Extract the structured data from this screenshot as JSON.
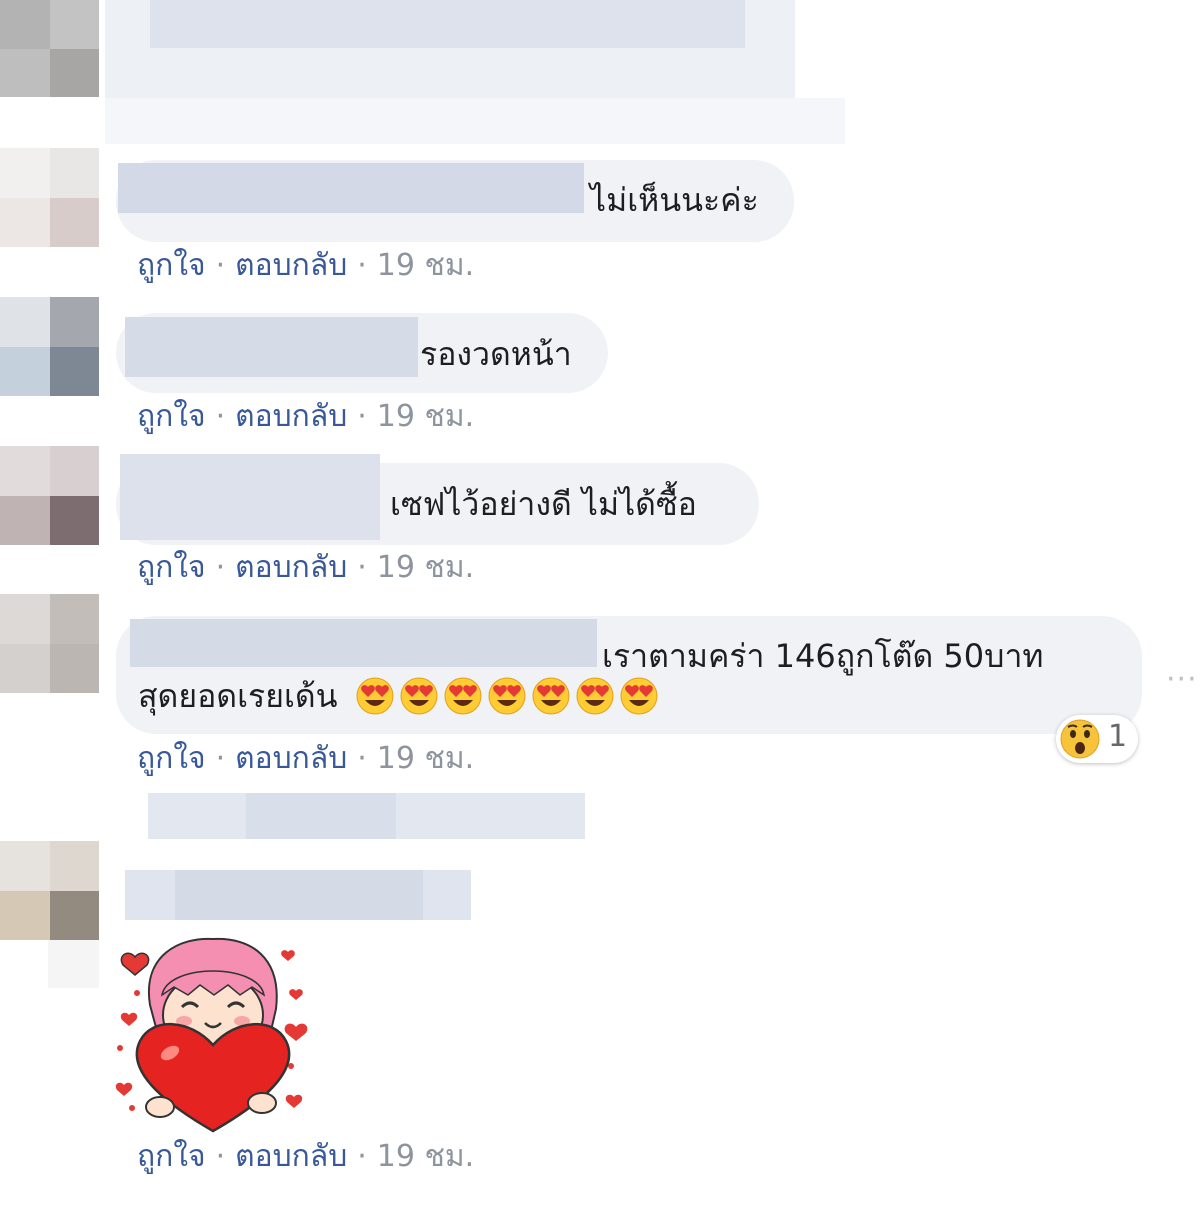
{
  "comments": [
    {
      "text": "ไม่เห็นนะค่ะ",
      "like": "ถูกใจ",
      "reply": "ตอบกลับ",
      "time": "19 ชม."
    },
    {
      "text": "รองวดหน้า",
      "like": "ถูกใจ",
      "reply": "ตอบกลับ",
      "time": "19 ชม."
    },
    {
      "text": "เซฟไว้อย่างดี ไม่ได้ซื้อ",
      "like": "ถูกใจ",
      "reply": "ตอบกลับ",
      "time": "19 ชม."
    },
    {
      "text_line1": "เราตามคร่า 146ถูกโต๊ด 50บาท",
      "text_line2": "สุดยอดเรยเด้น",
      "emoji": "heart-eyes-emoji",
      "emoji_count": 7,
      "reaction": {
        "icon": "wow-emoji",
        "count": "1"
      },
      "like": "ถูกใจ",
      "reply": "ตอบกลับ",
      "time": "19 ชม."
    },
    {
      "sticker": "girl-hugging-heart-sticker",
      "like": "ถูกใจ",
      "reply": "ตอบกลับ",
      "time": "19 ชม."
    }
  ],
  "more_options": "···",
  "separator": "·",
  "colors": {
    "bubble": "#f0f2f5",
    "link": "#385898",
    "meta": "#8d949e"
  }
}
